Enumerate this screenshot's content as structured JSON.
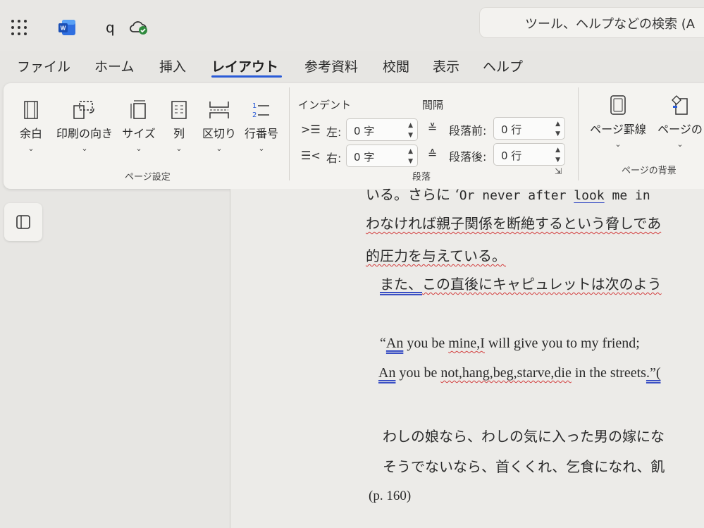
{
  "titlebar": {
    "app_icon": "word-logo",
    "doc_name": "q",
    "save_status_icon": "cloud-check-icon",
    "search_placeholder": "ツール、ヘルプなどの検索 (A"
  },
  "menu": {
    "tabs": [
      "ファイル",
      "ホーム",
      "挿入",
      "レイアウト",
      "参考資料",
      "校閲",
      "表示",
      "ヘルプ"
    ],
    "active": "レイアウト"
  },
  "ribbon": {
    "page_setup": {
      "buttons": [
        {
          "label": "余白",
          "icon": "margins-icon"
        },
        {
          "label": "印刷の向き",
          "icon": "orientation-icon"
        },
        {
          "label": "サイズ",
          "icon": "size-icon"
        },
        {
          "label": "列",
          "icon": "columns-icon"
        },
        {
          "label": "区切り",
          "icon": "breaks-icon"
        },
        {
          "label": "行番号",
          "icon": "line-numbers-icon"
        }
      ],
      "group_label": "ページ設定"
    },
    "paragraph": {
      "indent_head": "インデント",
      "spacing_head": "間隔",
      "indent_left_label": "左:",
      "indent_left_value": "0 字",
      "indent_right_label": "右:",
      "indent_right_value": "0 字",
      "space_before_label": "段落前:",
      "space_before_value": "0 行",
      "space_after_label": "段落後:",
      "space_after_value": "0 行",
      "group_label": "段落"
    },
    "page_background": {
      "buttons": [
        {
          "label": "ページ罫線",
          "icon": "page-borders-icon"
        },
        {
          "label": "ページの",
          "icon": "page-color-icon"
        }
      ],
      "group_label": "ページの背景"
    }
  },
  "document": {
    "line1_jp": "いる。さらに ‘",
    "line1_en_a": "Or never after ",
    "line1_en_look": "look",
    "line1_en_b": " me in",
    "line2": "わなければ親子関係を断絶するという脅しであ",
    "line3": "的圧力を与えている。",
    "line4_a": "また、",
    "line4_b": "この直後にキャピュレットは次のよう",
    "quote1_open": "“",
    "quote1_an": "An",
    "quote1_mid": " you be ",
    "quote1_mine": "mine,I",
    "quote1_end": " will give you to my friend;",
    "quote2_an": "An",
    "quote2_mid": " you be ",
    "quote2_words": "not,hang,beg,starve,die",
    "quote2_end": " in the streets",
    "quote2_tail": ".”(",
    "trans1": "わしの娘なら、わしの気に入った男の嫁にな",
    "trans2": "そうでないなら、首くくれ、乞食になれ、飢",
    "page_ref": "(p. 160)"
  }
}
